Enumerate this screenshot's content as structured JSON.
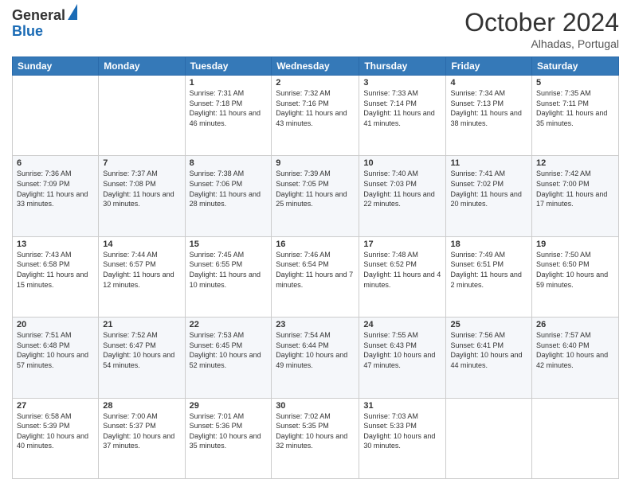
{
  "header": {
    "logo": {
      "general": "General",
      "blue": "Blue"
    },
    "title": "October 2024",
    "subtitle": "Alhadas, Portugal"
  },
  "columns": [
    "Sunday",
    "Monday",
    "Tuesday",
    "Wednesday",
    "Thursday",
    "Friday",
    "Saturday"
  ],
  "weeks": [
    [
      {
        "day": "",
        "sunrise": "",
        "sunset": "",
        "daylight": ""
      },
      {
        "day": "",
        "sunrise": "",
        "sunset": "",
        "daylight": ""
      },
      {
        "day": "1",
        "sunrise": "Sunrise: 7:31 AM",
        "sunset": "Sunset: 7:18 PM",
        "daylight": "Daylight: 11 hours and 46 minutes."
      },
      {
        "day": "2",
        "sunrise": "Sunrise: 7:32 AM",
        "sunset": "Sunset: 7:16 PM",
        "daylight": "Daylight: 11 hours and 43 minutes."
      },
      {
        "day": "3",
        "sunrise": "Sunrise: 7:33 AM",
        "sunset": "Sunset: 7:14 PM",
        "daylight": "Daylight: 11 hours and 41 minutes."
      },
      {
        "day": "4",
        "sunrise": "Sunrise: 7:34 AM",
        "sunset": "Sunset: 7:13 PM",
        "daylight": "Daylight: 11 hours and 38 minutes."
      },
      {
        "day": "5",
        "sunrise": "Sunrise: 7:35 AM",
        "sunset": "Sunset: 7:11 PM",
        "daylight": "Daylight: 11 hours and 35 minutes."
      }
    ],
    [
      {
        "day": "6",
        "sunrise": "Sunrise: 7:36 AM",
        "sunset": "Sunset: 7:09 PM",
        "daylight": "Daylight: 11 hours and 33 minutes."
      },
      {
        "day": "7",
        "sunrise": "Sunrise: 7:37 AM",
        "sunset": "Sunset: 7:08 PM",
        "daylight": "Daylight: 11 hours and 30 minutes."
      },
      {
        "day": "8",
        "sunrise": "Sunrise: 7:38 AM",
        "sunset": "Sunset: 7:06 PM",
        "daylight": "Daylight: 11 hours and 28 minutes."
      },
      {
        "day": "9",
        "sunrise": "Sunrise: 7:39 AM",
        "sunset": "Sunset: 7:05 PM",
        "daylight": "Daylight: 11 hours and 25 minutes."
      },
      {
        "day": "10",
        "sunrise": "Sunrise: 7:40 AM",
        "sunset": "Sunset: 7:03 PM",
        "daylight": "Daylight: 11 hours and 22 minutes."
      },
      {
        "day": "11",
        "sunrise": "Sunrise: 7:41 AM",
        "sunset": "Sunset: 7:02 PM",
        "daylight": "Daylight: 11 hours and 20 minutes."
      },
      {
        "day": "12",
        "sunrise": "Sunrise: 7:42 AM",
        "sunset": "Sunset: 7:00 PM",
        "daylight": "Daylight: 11 hours and 17 minutes."
      }
    ],
    [
      {
        "day": "13",
        "sunrise": "Sunrise: 7:43 AM",
        "sunset": "Sunset: 6:58 PM",
        "daylight": "Daylight: 11 hours and 15 minutes."
      },
      {
        "day": "14",
        "sunrise": "Sunrise: 7:44 AM",
        "sunset": "Sunset: 6:57 PM",
        "daylight": "Daylight: 11 hours and 12 minutes."
      },
      {
        "day": "15",
        "sunrise": "Sunrise: 7:45 AM",
        "sunset": "Sunset: 6:55 PM",
        "daylight": "Daylight: 11 hours and 10 minutes."
      },
      {
        "day": "16",
        "sunrise": "Sunrise: 7:46 AM",
        "sunset": "Sunset: 6:54 PM",
        "daylight": "Daylight: 11 hours and 7 minutes."
      },
      {
        "day": "17",
        "sunrise": "Sunrise: 7:48 AM",
        "sunset": "Sunset: 6:52 PM",
        "daylight": "Daylight: 11 hours and 4 minutes."
      },
      {
        "day": "18",
        "sunrise": "Sunrise: 7:49 AM",
        "sunset": "Sunset: 6:51 PM",
        "daylight": "Daylight: 11 hours and 2 minutes."
      },
      {
        "day": "19",
        "sunrise": "Sunrise: 7:50 AM",
        "sunset": "Sunset: 6:50 PM",
        "daylight": "Daylight: 10 hours and 59 minutes."
      }
    ],
    [
      {
        "day": "20",
        "sunrise": "Sunrise: 7:51 AM",
        "sunset": "Sunset: 6:48 PM",
        "daylight": "Daylight: 10 hours and 57 minutes."
      },
      {
        "day": "21",
        "sunrise": "Sunrise: 7:52 AM",
        "sunset": "Sunset: 6:47 PM",
        "daylight": "Daylight: 10 hours and 54 minutes."
      },
      {
        "day": "22",
        "sunrise": "Sunrise: 7:53 AM",
        "sunset": "Sunset: 6:45 PM",
        "daylight": "Daylight: 10 hours and 52 minutes."
      },
      {
        "day": "23",
        "sunrise": "Sunrise: 7:54 AM",
        "sunset": "Sunset: 6:44 PM",
        "daylight": "Daylight: 10 hours and 49 minutes."
      },
      {
        "day": "24",
        "sunrise": "Sunrise: 7:55 AM",
        "sunset": "Sunset: 6:43 PM",
        "daylight": "Daylight: 10 hours and 47 minutes."
      },
      {
        "day": "25",
        "sunrise": "Sunrise: 7:56 AM",
        "sunset": "Sunset: 6:41 PM",
        "daylight": "Daylight: 10 hours and 44 minutes."
      },
      {
        "day": "26",
        "sunrise": "Sunrise: 7:57 AM",
        "sunset": "Sunset: 6:40 PM",
        "daylight": "Daylight: 10 hours and 42 minutes."
      }
    ],
    [
      {
        "day": "27",
        "sunrise": "Sunrise: 6:58 AM",
        "sunset": "Sunset: 5:39 PM",
        "daylight": "Daylight: 10 hours and 40 minutes."
      },
      {
        "day": "28",
        "sunrise": "Sunrise: 7:00 AM",
        "sunset": "Sunset: 5:37 PM",
        "daylight": "Daylight: 10 hours and 37 minutes."
      },
      {
        "day": "29",
        "sunrise": "Sunrise: 7:01 AM",
        "sunset": "Sunset: 5:36 PM",
        "daylight": "Daylight: 10 hours and 35 minutes."
      },
      {
        "day": "30",
        "sunrise": "Sunrise: 7:02 AM",
        "sunset": "Sunset: 5:35 PM",
        "daylight": "Daylight: 10 hours and 32 minutes."
      },
      {
        "day": "31",
        "sunrise": "Sunrise: 7:03 AM",
        "sunset": "Sunset: 5:33 PM",
        "daylight": "Daylight: 10 hours and 30 minutes."
      },
      {
        "day": "",
        "sunrise": "",
        "sunset": "",
        "daylight": ""
      },
      {
        "day": "",
        "sunrise": "",
        "sunset": "",
        "daylight": ""
      }
    ]
  ]
}
